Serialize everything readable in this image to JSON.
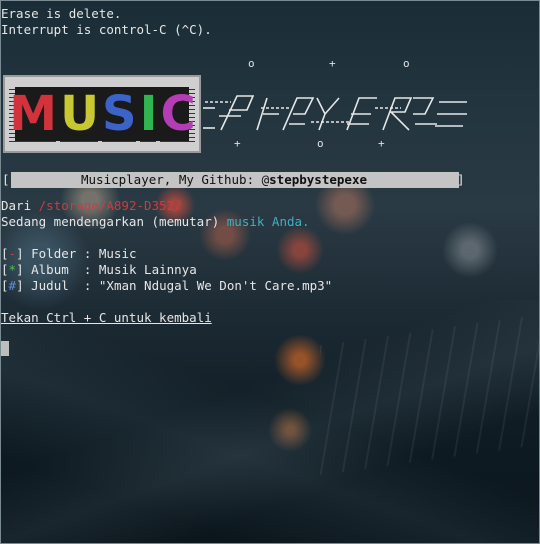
{
  "intro": {
    "line1": "Erase is delete.",
    "line2": "Interrupt is control-C (^C)."
  },
  "logo": {
    "letters": [
      "M",
      "U",
      "S",
      "I",
      "C"
    ],
    "letter_colors": [
      "#d2323c",
      "#c8c832",
      "#3c64c8",
      "#32b450",
      "#b43cb4"
    ],
    "wordmark": "player"
  },
  "banner": {
    "open_bracket": "[",
    "close_bracket": "]",
    "text_prefix": "Musicplayer, My Github: @",
    "text_bold": "stepbystepexe"
  },
  "info": {
    "from_label": "Dari",
    "from_path": "/storage/A892-D352/",
    "listening_prefix": "Sedang mendengarkan (memutar)",
    "listening_suffix": "musik Anda."
  },
  "fields": [
    {
      "mark": "-",
      "label": "Folder",
      "sep": ":",
      "value": "Music"
    },
    {
      "mark": "*",
      "label": "Album",
      "sep": ":",
      "value": "Musik Lainnya"
    },
    {
      "mark": "#",
      "label": "Judul",
      "sep": ":",
      "value": "\"Xman Ndugal We Don't Care.mp3\""
    }
  ],
  "footer": {
    "exit_hint": "Tekan Ctrl + C untuk kembali"
  },
  "colors": {
    "accent_red": "#d23a3a",
    "accent_cyan": "#3fb0c0",
    "accent_blue": "#5b8de0",
    "accent_green": "#4cc24c",
    "banner_bg": "#c4c4c4"
  }
}
